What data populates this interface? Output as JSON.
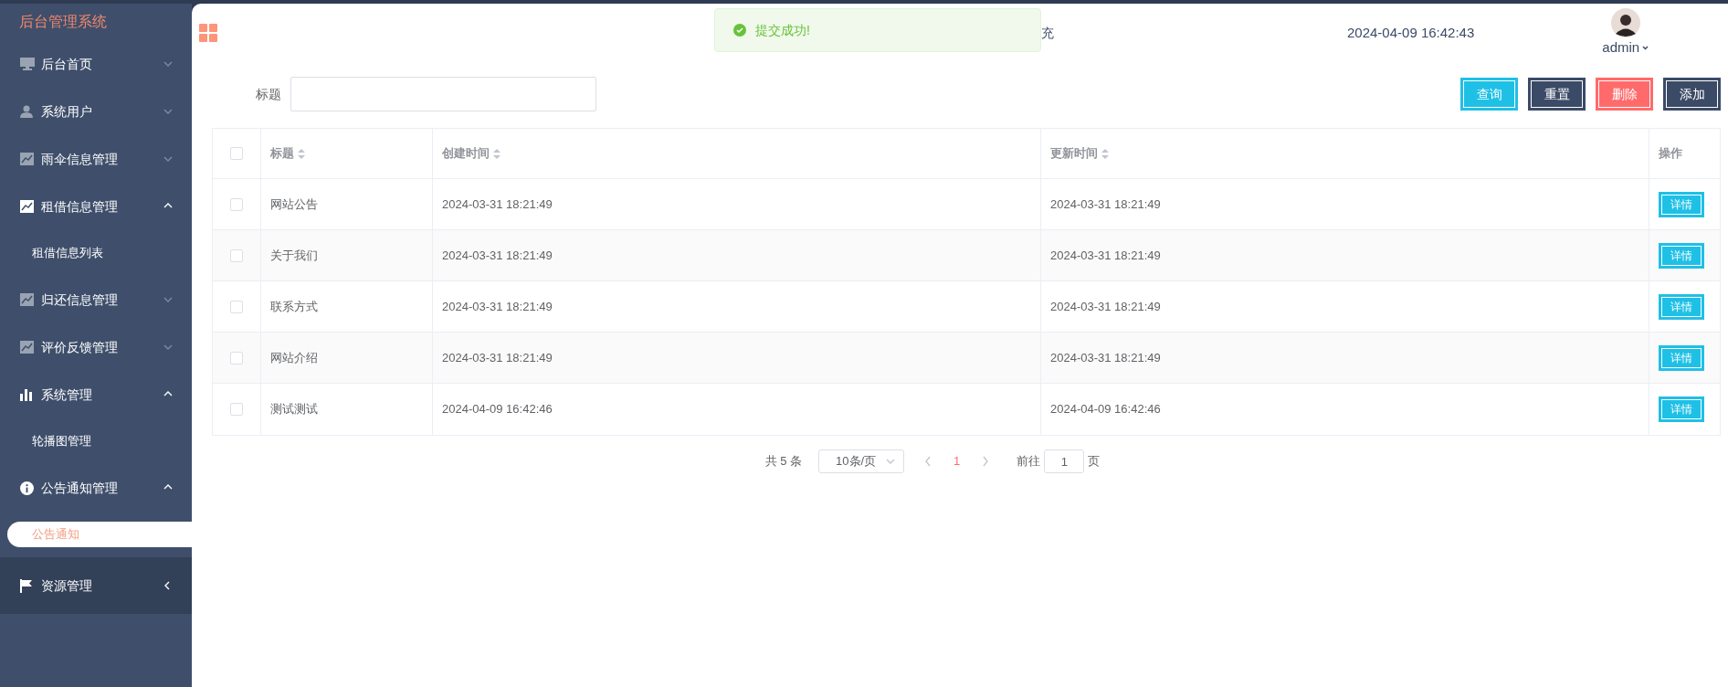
{
  "sidebar": {
    "title": "后台管理系统",
    "items": [
      {
        "label": "后台首页",
        "selected": false,
        "expanded": false,
        "hovered": false
      },
      {
        "label": "系统用户",
        "selected": false,
        "expanded": false,
        "hovered": false
      },
      {
        "label": "雨伞信息管理",
        "selected": false,
        "expanded": false,
        "hovered": false
      },
      {
        "label": "租借信息管理",
        "selected": false,
        "expanded": true,
        "hovered": false,
        "children": [
          {
            "label": "租借信息列表",
            "selected": false
          }
        ]
      },
      {
        "label": "归还信息管理",
        "selected": false,
        "expanded": false,
        "hovered": false
      },
      {
        "label": "评价反馈管理",
        "selected": false,
        "expanded": false,
        "hovered": false
      },
      {
        "label": "系统管理",
        "selected": false,
        "expanded": true,
        "hovered": false,
        "children": [
          {
            "label": "轮播图管理",
            "selected": false
          }
        ]
      },
      {
        "label": "公告通知管理",
        "selected": false,
        "expanded": true,
        "hovered": false,
        "children": [
          {
            "label": "公告通知",
            "selected": true
          }
        ]
      },
      {
        "label": "资源管理",
        "selected": false,
        "expanded": false,
        "hovered": true
      }
    ]
  },
  "header": {
    "title_fragment": "充",
    "datetime": "2024-04-09 16:42:43",
    "user": "admin"
  },
  "toast": {
    "message": "提交成功!"
  },
  "search": {
    "label": "标题"
  },
  "buttons": [
    {
      "label": "查询",
      "kind": "primary"
    },
    {
      "label": "重置",
      "kind": "dark"
    },
    {
      "label": "删除",
      "kind": "danger"
    },
    {
      "label": "添加",
      "kind": "dark"
    }
  ],
  "table": {
    "all_checked": false,
    "columns": [
      {
        "label": "标题",
        "sortable": true
      },
      {
        "label": "创建时间",
        "sortable": true
      },
      {
        "label": "更新时间",
        "sortable": true
      },
      {
        "label": "操作",
        "sortable": false
      }
    ],
    "rows": [
      {
        "checked": false,
        "cells": [
          "网站公告",
          "2024-03-31 18:21:49",
          "2024-03-31 18:21:49"
        ],
        "action": "详情"
      },
      {
        "checked": false,
        "cells": [
          "关于我们",
          "2024-03-31 18:21:49",
          "2024-03-31 18:21:49"
        ],
        "action": "详情"
      },
      {
        "checked": false,
        "cells": [
          "联系方式",
          "2024-03-31 18:21:49",
          "2024-03-31 18:21:49"
        ],
        "action": "详情"
      },
      {
        "checked": false,
        "cells": [
          "网站介绍",
          "2024-03-31 18:21:49",
          "2024-03-31 18:21:49"
        ],
        "action": "详情"
      },
      {
        "checked": false,
        "cells": [
          "测试测试",
          "2024-04-09 16:42:46",
          "2024-04-09 16:42:46"
        ],
        "action": "详情"
      }
    ]
  },
  "pagination": {
    "total": "共 5 条",
    "page_size": "10条/页",
    "pages": [
      {
        "label": "1",
        "selected": true
      }
    ],
    "goto_label": "前往",
    "goto_value": "1",
    "goto_suffix": "页"
  }
}
